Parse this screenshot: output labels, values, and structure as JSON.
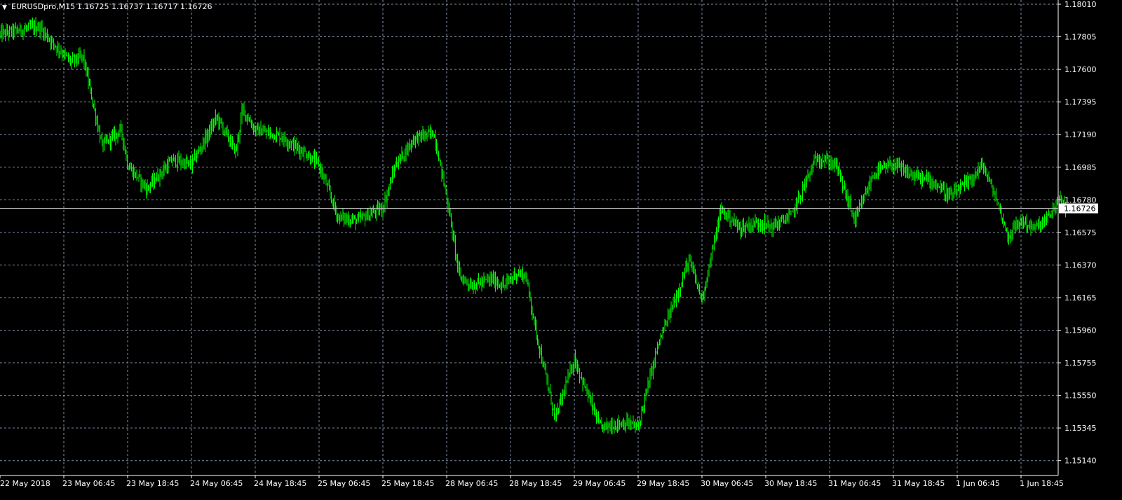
{
  "header": {
    "menu_glyph": "▼",
    "symbol_timeframe": "EURUSDpro,M15",
    "ohlc": "1.16725 1.16737 1.16717 1.16726"
  },
  "colors": {
    "background": "#000000",
    "grid": "#7f8fa8",
    "bars": "#00ff00",
    "axis": "#ffffff",
    "text": "#ffffff",
    "price_line": "#c0c0c0"
  },
  "chart_data": {
    "type": "line",
    "chart_style": "bars",
    "grid": true,
    "current_price": 1.16726,
    "ylim": [
      1.1511,
      1.1804
    ],
    "y_ticks": [
      "1.18010",
      "1.17805",
      "1.17600",
      "1.17395",
      "1.17190",
      "1.16985",
      "1.16780",
      "1.16575",
      "1.16370",
      "1.16165",
      "1.15960",
      "1.15755",
      "1.15550",
      "1.15345",
      "1.15140"
    ],
    "x_ticks": [
      "22 May 2018",
      "23 May 06:45",
      "23 May 18:45",
      "24 May 06:45",
      "24 May 18:45",
      "25 May 06:45",
      "25 May 18:45",
      "28 May 06:45",
      "28 May 18:45",
      "29 May 06:45",
      "29 May 18:45",
      "30 May 06:45",
      "30 May 18:45",
      "31 May 06:45",
      "31 May 18:45",
      "1 Jun 06:45",
      "1 Jun 18:45"
    ],
    "x_step": "12h",
    "series": [
      {
        "x": [
          "22 May 2018",
          "",
          "",
          "",
          "23 May 06:45",
          "",
          "",
          "23 May 18:45",
          "",
          "",
          "24 May 06:45",
          "",
          "",
          "",
          "24 May 18:45",
          "",
          "",
          "25 May 06:45",
          "",
          "",
          "25 May 18:45",
          "",
          "",
          "",
          "28 May 06:45",
          "",
          "",
          "",
          "28 May 18:45",
          "",
          "",
          "",
          "29 May 06:45",
          "",
          "",
          "",
          "29 May 18:45",
          "",
          "",
          "30 May 06:45",
          "",
          "",
          "",
          "30 May 18:45",
          "",
          "",
          "",
          "31 May 06:45",
          "",
          "",
          "",
          "31 May 18:45",
          "",
          "",
          "",
          "1 Jun 06:45",
          "",
          "",
          "",
          "",
          "1 Jun 18:45",
          ""
        ],
        "t": [
          0,
          0.1,
          0.3,
          0.55,
          0.65,
          0.8,
          0.95,
          1.0,
          1.15,
          1.35,
          1.5,
          1.7,
          1.85,
          1.9,
          2.0,
          2.2,
          2.4,
          2.5,
          2.65,
          2.8,
          3.0,
          3.1,
          3.25,
          3.4,
          3.5,
          3.6,
          3.7,
          3.85,
          3.95,
          4.05,
          4.12,
          4.2,
          4.35,
          4.5,
          4.7,
          4.9,
          5.0,
          5.15,
          5.4,
          5.5,
          5.65,
          5.8,
          5.95,
          6.05,
          6.2,
          6.4,
          6.55,
          6.7,
          6.85,
          7.0,
          7.15,
          7.3,
          7.45,
          7.6,
          7.7,
          7.8,
          7.9,
          8.0,
          8.1,
          8.2,
          8.3,
          8.35
        ],
        "y": [
          1.1782,
          1.1784,
          1.1787,
          1.1765,
          1.1768,
          1.1712,
          1.1722,
          1.17,
          1.1685,
          1.1703,
          1.17,
          1.173,
          1.1708,
          1.1735,
          1.1722,
          1.1718,
          1.1707,
          1.17,
          1.1667,
          1.1665,
          1.1673,
          1.17,
          1.1717,
          1.172,
          1.168,
          1.163,
          1.1624,
          1.1628,
          1.1624,
          1.1632,
          1.163,
          1.1595,
          1.154,
          1.1578,
          1.1535,
          1.1538,
          1.1535,
          1.1585,
          1.164,
          1.1615,
          1.1672,
          1.166,
          1.1664,
          1.1661,
          1.1668,
          1.1705,
          1.17,
          1.1665,
          1.1695,
          1.17,
          1.1693,
          1.169,
          1.168,
          1.169,
          1.17,
          1.168,
          1.1655,
          1.1665,
          1.166,
          1.1665,
          1.1678,
          1.16726
        ]
      }
    ]
  }
}
